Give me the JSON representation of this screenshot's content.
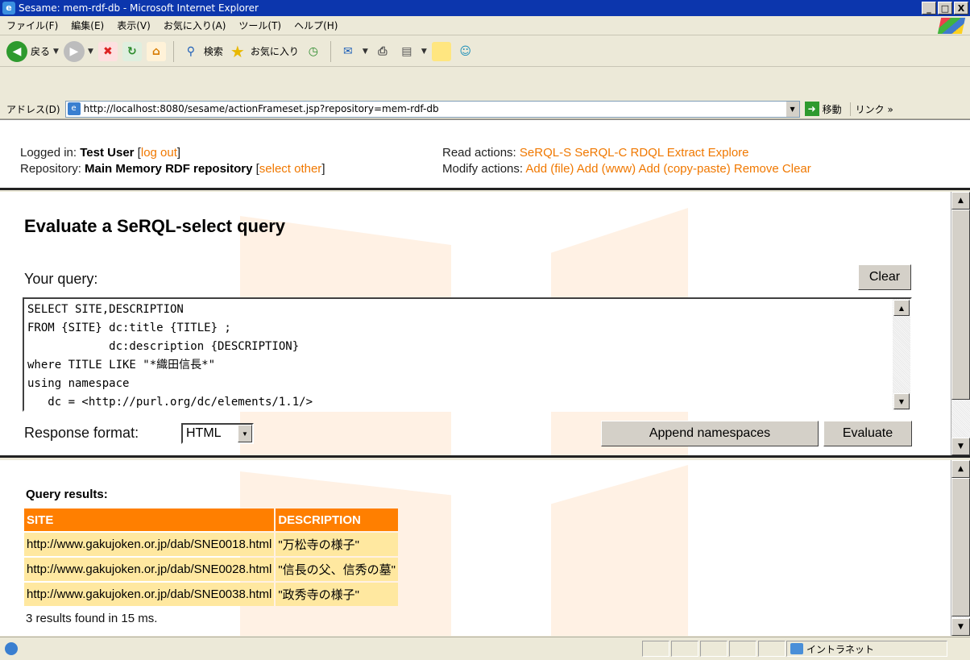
{
  "window": {
    "title": "Sesame: mem-rdf-db - Microsoft Internet Explorer",
    "buttons": [
      "_",
      "□",
      "X"
    ]
  },
  "menu": {
    "items": [
      "ファイル(F)",
      "編集(E)",
      "表示(V)",
      "お気に入り(A)",
      "ツール(T)",
      "ヘルプ(H)"
    ]
  },
  "toolbar": {
    "back_label": "戻る",
    "search_label": "検索",
    "favorites_label": "お気に入り"
  },
  "address": {
    "label": "アドレス(D)",
    "url": "http://localhost:8080/sesame/actionFrameset.jsp?repository=mem-rdf-db",
    "go_label": "移動",
    "links_label": "リンク »"
  },
  "header": {
    "logged_in_label": "Logged in:",
    "user": "Test User",
    "logout": "log out",
    "repository_label": "Repository:",
    "repository": "Main Memory RDF repository",
    "select_other": "select other",
    "read_label": "Read actions:",
    "read_actions": [
      "SeRQL-S",
      "SeRQL-C",
      "RDQL",
      "Extract",
      "Explore"
    ],
    "modify_label": "Modify actions:",
    "modify_actions": [
      "Add (file)",
      "Add (www)",
      "Add (copy-paste)",
      "Remove",
      "Clear"
    ]
  },
  "query": {
    "title": "Evaluate a SeRQL-select query",
    "your_query_label": "Your query:",
    "clear_button": "Clear",
    "text": "SELECT SITE,DESCRIPTION\nFROM {SITE} dc:title {TITLE} ;\n            dc:description {DESCRIPTION}\nwhere TITLE LIKE \"*織田信長*\"\nusing namespace\n   dc = <http://purl.org/dc/elements/1.1/>",
    "response_format_label": "Response format:",
    "response_format_value": "HTML",
    "append_button": "Append namespaces",
    "evaluate_button": "Evaluate"
  },
  "results": {
    "title": "Query results:",
    "columns": [
      "SITE",
      "DESCRIPTION"
    ],
    "rows": [
      [
        "http://www.gakujoken.or.jp/dab/SNE0018.html",
        "\"万松寺の様子\""
      ],
      [
        "http://www.gakujoken.or.jp/dab/SNE0028.html",
        "\"信長の父、信秀の墓\""
      ],
      [
        "http://www.gakujoken.or.jp/dab/SNE0038.html",
        "\"政秀寺の様子\""
      ]
    ],
    "summary": "3 results found in 15 ms."
  },
  "status": {
    "zone": "イントラネット"
  }
}
